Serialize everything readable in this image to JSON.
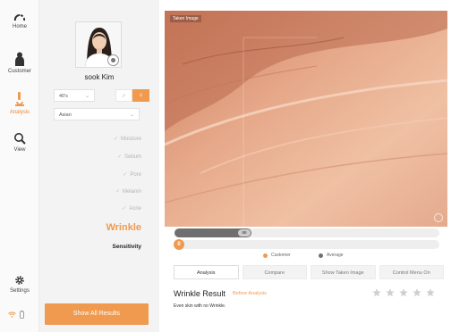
{
  "nav": {
    "items": [
      {
        "label": "Home",
        "icon": "home-icon"
      },
      {
        "label": "Customer",
        "icon": "customer-icon"
      },
      {
        "label": "Analysis",
        "icon": "analysis-icon",
        "active": true
      },
      {
        "label": "View",
        "icon": "view-icon"
      }
    ],
    "settings_label": "Settings"
  },
  "customer": {
    "name": "sook Kim",
    "age_group": "40's",
    "ethnicity": "Asian",
    "selected_gender": "female"
  },
  "analysis_items": [
    {
      "label": "Moisture",
      "done": true
    },
    {
      "label": "Sebum",
      "done": true
    },
    {
      "label": "Pore",
      "done": true
    },
    {
      "label": "Melanin",
      "done": true
    },
    {
      "label": "Acne",
      "done": true
    },
    {
      "label": "Wrinkle",
      "current": true
    },
    {
      "label": "Sensitivity"
    }
  ],
  "show_all_label": "Show All Results",
  "image": {
    "tag": "Taken Image"
  },
  "scores": {
    "average_value": "88",
    "average_fraction": 0.29,
    "customer_value": "0",
    "customer_fraction": 0.0
  },
  "legend": {
    "customer": "Customer",
    "average": "Average"
  },
  "colors": {
    "accent": "#ef9a4e",
    "average": "#6f6f6f"
  },
  "tabs": [
    "Analysis",
    "Compare",
    "Show Taken Image",
    "Control Menu On"
  ],
  "result": {
    "title": "Wrinkle Result",
    "subtitle": "Before Analysis",
    "description": "Even skin with no Wrinkle.",
    "stars_filled": 0,
    "stars_total": 5
  }
}
